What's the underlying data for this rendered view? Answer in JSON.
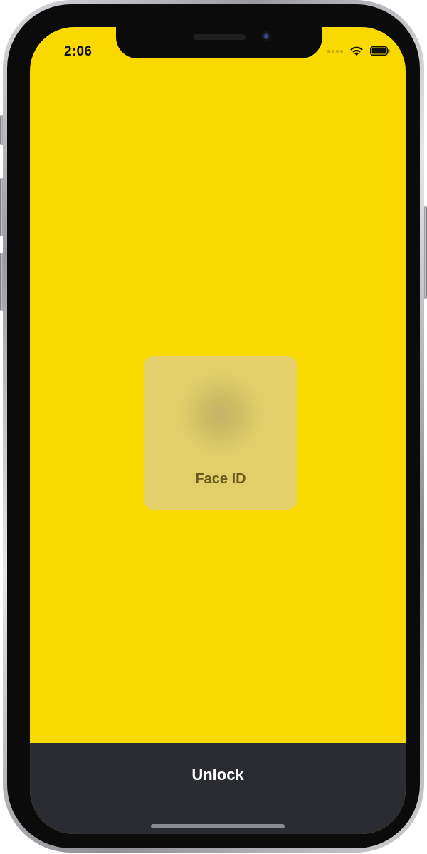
{
  "status_bar": {
    "time": "2:06",
    "signal_icon": "signal-dots-icon",
    "wifi_icon": "wifi-icon",
    "battery_icon": "battery-icon"
  },
  "face_id": {
    "label": "Face ID",
    "icon": "face-id-icon"
  },
  "unlock": {
    "label": "Unlock"
  },
  "colors": {
    "screen_background": "#f9d900",
    "card_background": "#e2cf6b",
    "bottom_bar": "#2a2c32",
    "label_text": "#6b5a20"
  }
}
